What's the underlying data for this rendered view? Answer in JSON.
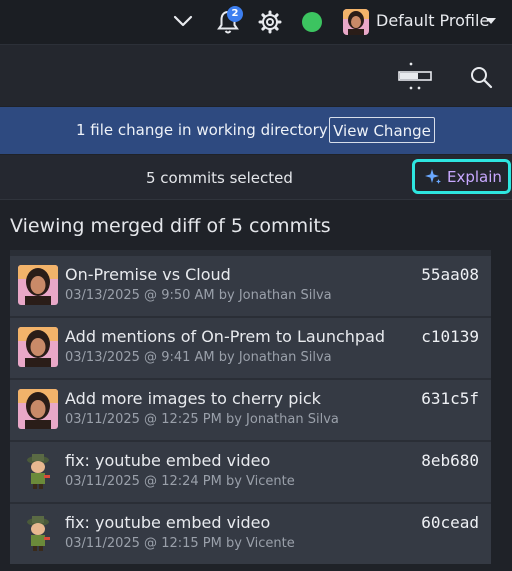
{
  "topbar": {
    "notification_count": "2",
    "status_color": "#3cc460",
    "profile_name": "Default Profile"
  },
  "banner": {
    "message": "1 file change in working directory",
    "button_label": "View Change"
  },
  "selection": {
    "text": "5 commits selected",
    "explain_label": "Explain"
  },
  "main": {
    "heading": "Viewing merged diff of 5 commits"
  },
  "commits": [
    {
      "title": "On-Premise vs Cloud",
      "meta": "03/13/2025 @ 9:50 AM by Jonathan Silva",
      "sha": "55aa08",
      "avatar": "person-avatar"
    },
    {
      "title": "Add mentions of On-Prem to Launchpad",
      "meta": "03/13/2025 @ 9:41 AM by Jonathan Silva",
      "sha": "c10139",
      "avatar": "person-avatar"
    },
    {
      "title": "Add more images to cherry pick",
      "meta": "03/11/2025 @ 12:25 PM by Jonathan Silva",
      "sha": "631c5f",
      "avatar": "person-avatar"
    },
    {
      "title": "fix: youtube embed video",
      "meta": "03/11/2025 @ 12:24 PM by Vicente",
      "sha": "8eb680",
      "avatar": "character-avatar"
    },
    {
      "title": "fix: youtube embed video",
      "meta": "03/11/2025 @ 12:15 PM by Vicente",
      "sha": "60cead",
      "avatar": "character-avatar"
    }
  ]
}
